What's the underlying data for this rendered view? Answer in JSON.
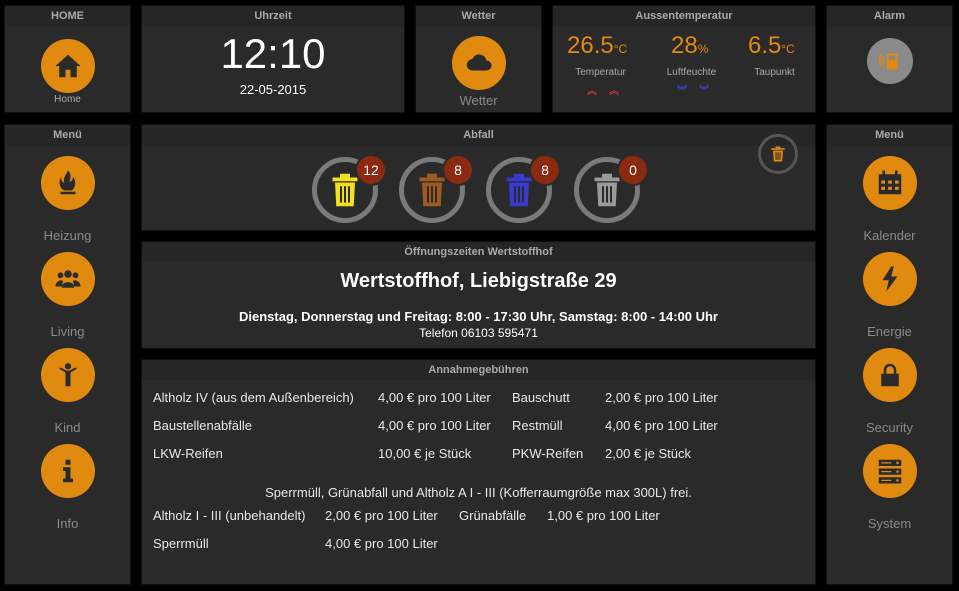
{
  "home": {
    "header": "HOME",
    "label": "Home"
  },
  "clock": {
    "header": "Uhrzeit",
    "time": "12:10",
    "date": "22-05-2015"
  },
  "weather": {
    "header": "Wetter",
    "label": "Wetter"
  },
  "outside": {
    "header": "Aussentemperatur",
    "temp": {
      "value": "26.5",
      "unit": "°C",
      "label": "Temperatur"
    },
    "humidity": {
      "value": "28",
      "unit": "%",
      "label": "Luftfeuchte"
    },
    "dew": {
      "value": "6.5",
      "unit": "°C",
      "label": "Taupunkt"
    }
  },
  "alarm": {
    "header": "Alarm"
  },
  "left_menu": {
    "header": "Menü",
    "items": [
      {
        "label": "Heizung"
      },
      {
        "label": "Living"
      },
      {
        "label": "Kind"
      },
      {
        "label": "Info"
      }
    ]
  },
  "right_menu": {
    "header": "Menü",
    "items": [
      {
        "label": "Kalender"
      },
      {
        "label": "Energie"
      },
      {
        "label": "Security"
      },
      {
        "label": "System"
      }
    ]
  },
  "waste": {
    "header": "Abfall",
    "bins": [
      {
        "count": "12",
        "color": "#f0e020"
      },
      {
        "count": "8",
        "color": "#a05a20"
      },
      {
        "count": "8",
        "color": "#3a3ad0"
      },
      {
        "count": "0",
        "color": "#9a9a9a"
      }
    ]
  },
  "hours": {
    "header": "Öffnungszeiten Wertstoffhof",
    "title": "Wertstoffhof, Liebigstraße 29",
    "times": "Dienstag, Donnerstag und Freitag: 8:00 - 17:30 Uhr, Samstag: 8:00 - 14:00 Uhr",
    "phone": "Telefon 06103 595471"
  },
  "fees": {
    "header": "Annahmegebühren",
    "rows": [
      {
        "a": "Altholz IV (aus dem Außenbereich)",
        "ap": "4,00 € pro 100 Liter",
        "b": "Bauschutt",
        "bp": "2,00 € pro 100 Liter"
      },
      {
        "a": "Baustellenabfälle",
        "ap": "4,00 € pro 100 Liter",
        "b": "Restmüll",
        "bp": "4,00 € pro 100 Liter"
      },
      {
        "a": "LKW-Reifen",
        "ap": "10,00 € je Stück",
        "b": "PKW-Reifen",
        "bp": "2,00 € je Stück"
      }
    ],
    "note": "Sperrmüll, Grünabfall und Altholz A I - III (Kofferraumgröße max 300L) frei.",
    "rows2": [
      {
        "a": "Altholz I - III (unbehandelt)",
        "ap": "2,00 € pro 100 Liter",
        "b": "Grünabfälle",
        "bp": "1,00 € pro 100 Liter"
      },
      {
        "a": "Sperrmüll",
        "ap": "4,00 € pro 100 Liter"
      }
    ]
  }
}
